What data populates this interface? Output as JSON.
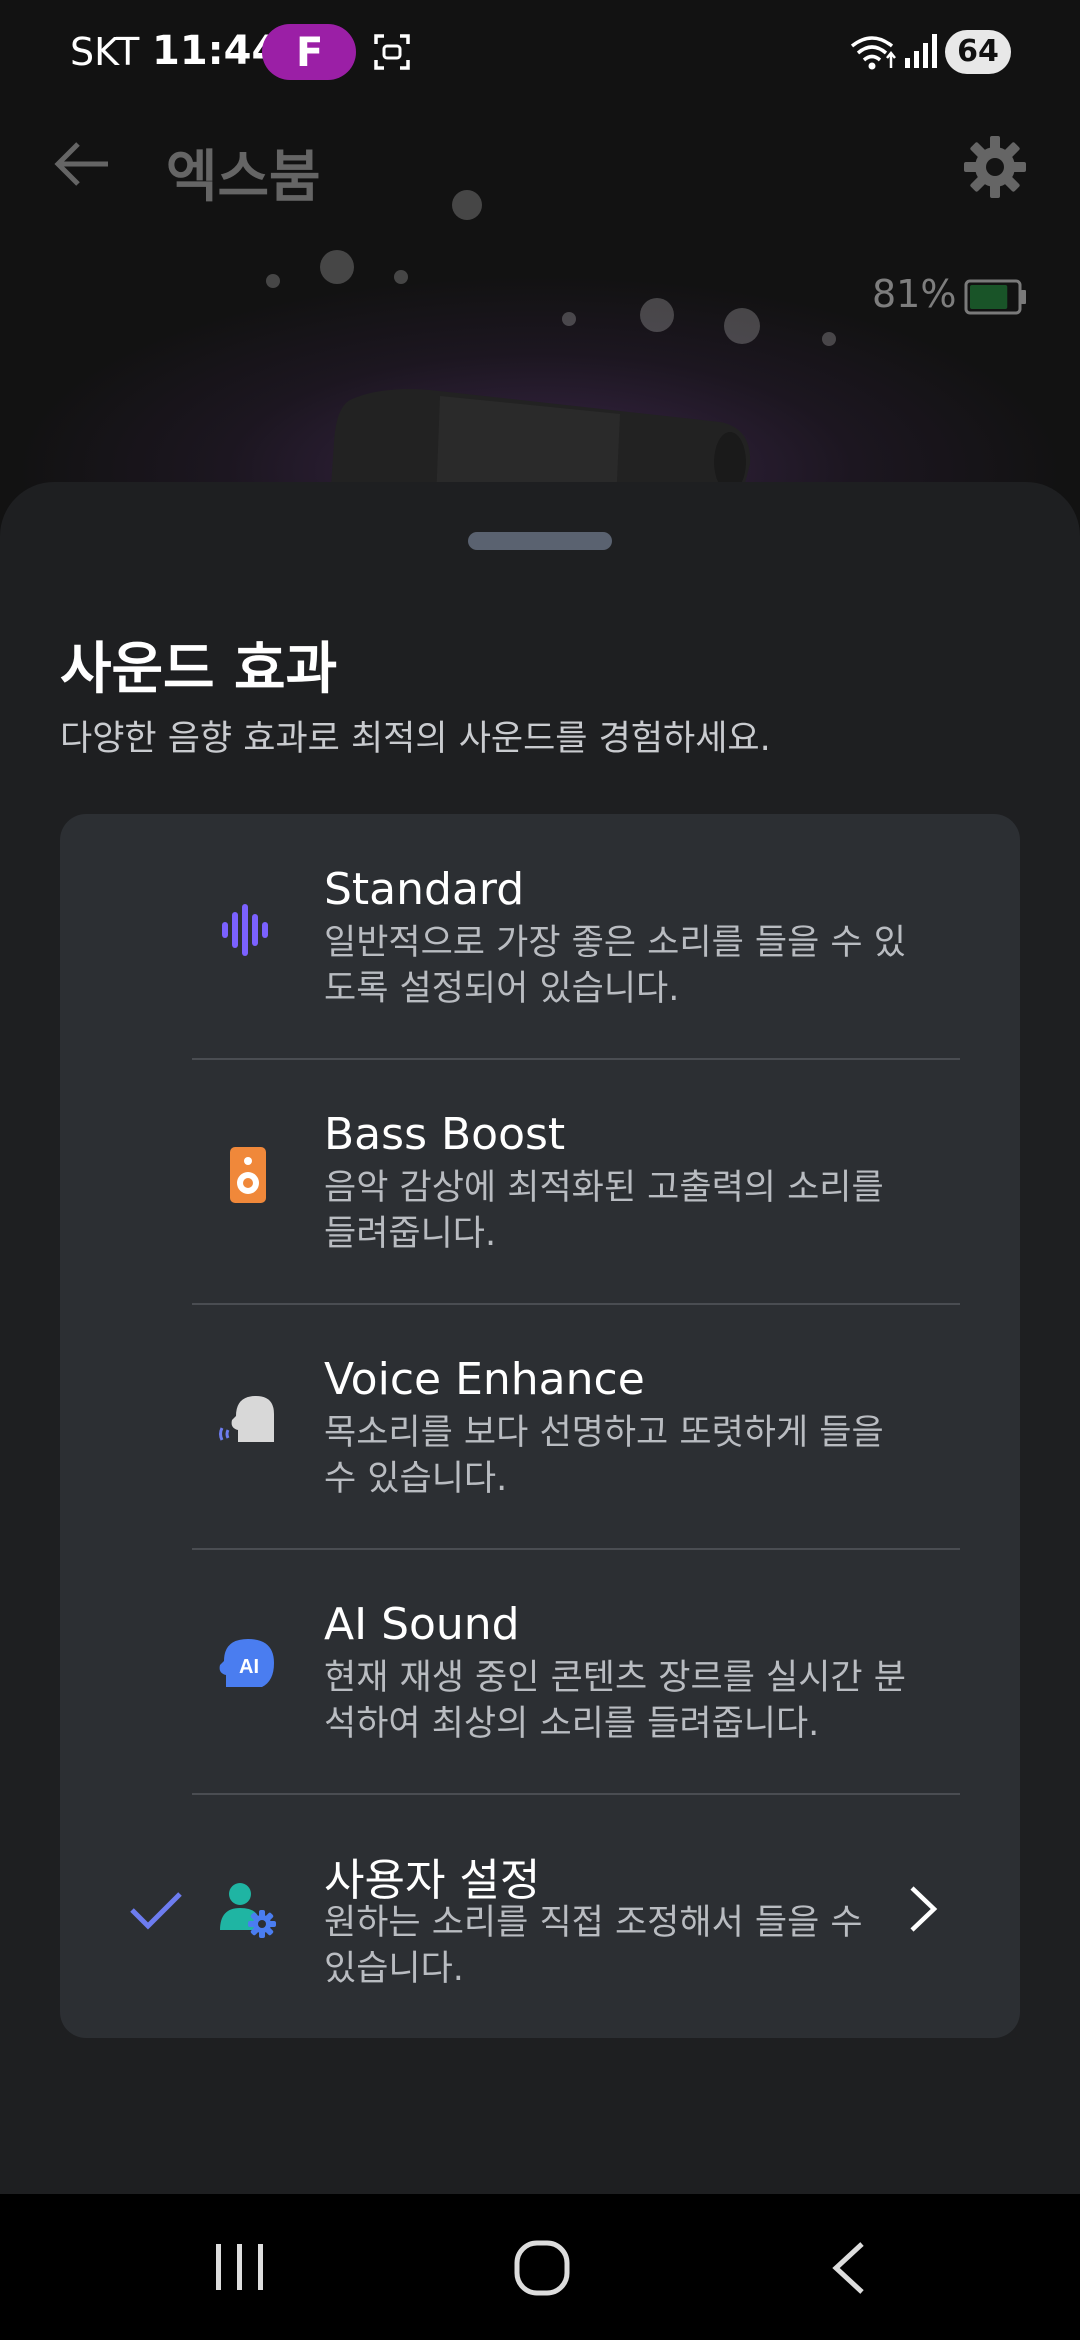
{
  "status_bar": {
    "carrier": "SKT",
    "time": "11:44",
    "app_badge_letter": "F",
    "battery_level": "64"
  },
  "app_bar": {
    "title": "엑스붐",
    "back_icon": "arrow-left-icon",
    "settings_icon": "gear-icon"
  },
  "device": {
    "battery_percent": "81%",
    "battery_fraction": 0.81
  },
  "sheet": {
    "title": "사운드 효과",
    "subtitle": "다양한 음향 효과로 최적의 사운드를 경험하세요.",
    "options": [
      {
        "title": "Standard",
        "description": "일반적으로 가장 좋은 소리를 들을 수 있도록 설정되어 있습니다.",
        "icon": "waveform-icon",
        "icon_color": "#7b61ff",
        "selected": false
      },
      {
        "title": "Bass Boost",
        "description": "음악 감상에 최적화된 고출력의 소리를 들려줍니다.",
        "icon": "speaker-icon",
        "icon_color": "#f0883a",
        "selected": false
      },
      {
        "title": "Voice Enhance",
        "description": "목소리를 보다 선명하고 또렷하게 들을 수 있습니다.",
        "icon": "voice-head-icon",
        "icon_color": "#d8d8d8",
        "selected": false
      },
      {
        "title": "AI Sound",
        "description": "현재 재생 중인 콘텐츠 장르를 실시간 분석하여 최상의 소리를 들려줍니다.",
        "icon": "ai-head-icon",
        "icon_badge": "AI",
        "icon_color": "#4a7df0",
        "selected": false
      },
      {
        "title": "사용자 설정",
        "description": "원하는 소리를 직접 조정해서 들을 수 있습니다.",
        "icon": "user-settings-icon",
        "icon_color": "#1fb5a3",
        "selected": true,
        "has_chevron": true
      }
    ]
  },
  "colors": {
    "accent": "#6d7cf0",
    "sheet_bg": "#1e1f21",
    "card_bg": "#2c2f33"
  },
  "nav_bar": {
    "recents_icon": "recents-icon",
    "home_icon": "home-icon",
    "back_icon": "back-chevron-icon"
  }
}
